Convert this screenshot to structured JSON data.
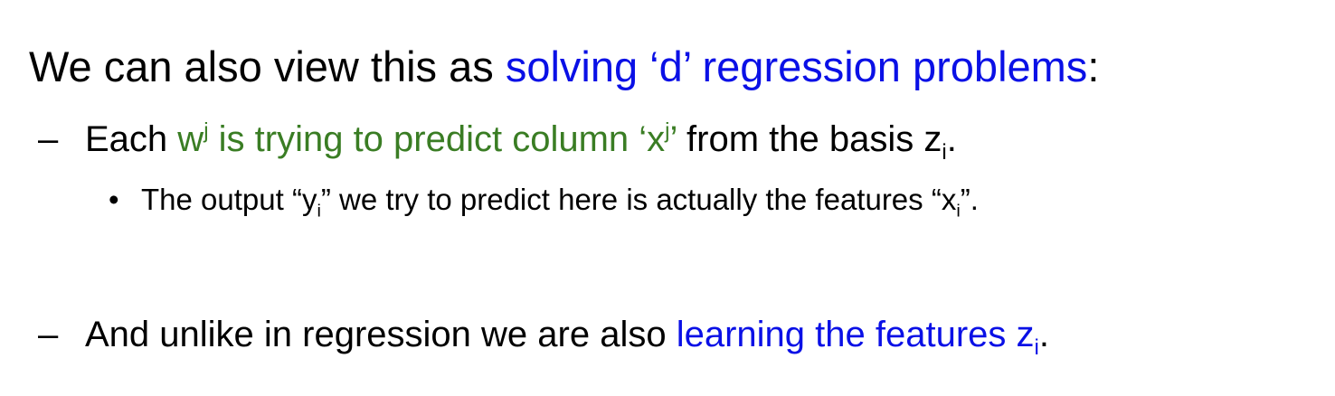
{
  "slide": {
    "heading": {
      "prefix": "We can also view this as ",
      "highlight": "solving ‘d’ regression problems",
      "suffix": ":"
    },
    "point1": {
      "dash": "–",
      "prefix": "Each ",
      "w": "w",
      "w_sup": "j",
      "green_mid": " is trying to predict column ‘x",
      "x_sup": "j",
      "green_end": "’",
      "suffix": " from the basis z",
      "z_sub": "i",
      "end": "."
    },
    "subpoint": {
      "bullet": "•",
      "prefix": "The output “y",
      "y_sub": "i",
      "middle": "” we try to predict here is actually the features “x",
      "x_sub": "i",
      "end": "”."
    },
    "point2": {
      "dash": "–",
      "prefix": "And unlike in regression we are also ",
      "highlight": "learning the features z",
      "z_sub": "i",
      "end": "."
    }
  },
  "colors": {
    "blue": "#0a10e6",
    "green": "#3a7d24",
    "text": "#000000"
  }
}
